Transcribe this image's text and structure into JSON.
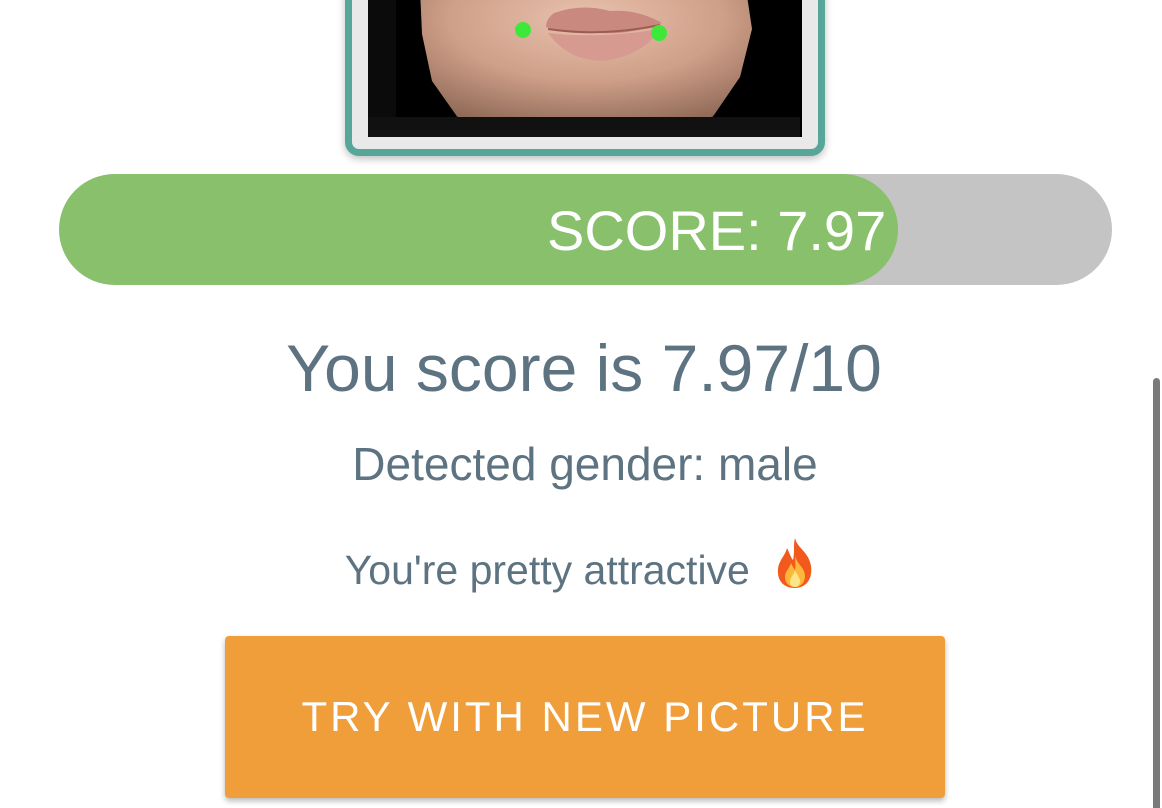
{
  "photo": {
    "alt": "face photo with landmark points",
    "frame_color": "#57a69a",
    "landmark_color": "#3ee83a"
  },
  "score_bar": {
    "label": "SCORE: 7.97",
    "value": 7.97,
    "max": 10,
    "fill_color": "#88c06b",
    "track_color": "#c4c4c4"
  },
  "result": {
    "headline": "You score is 7.97/10",
    "gender": "Detected gender: male",
    "verdict": "You're pretty attractive",
    "verdict_icon": "fire-icon"
  },
  "actions": {
    "try_again_label": "TRY WITH NEW PICTURE",
    "button_color": "#f09e3a"
  }
}
